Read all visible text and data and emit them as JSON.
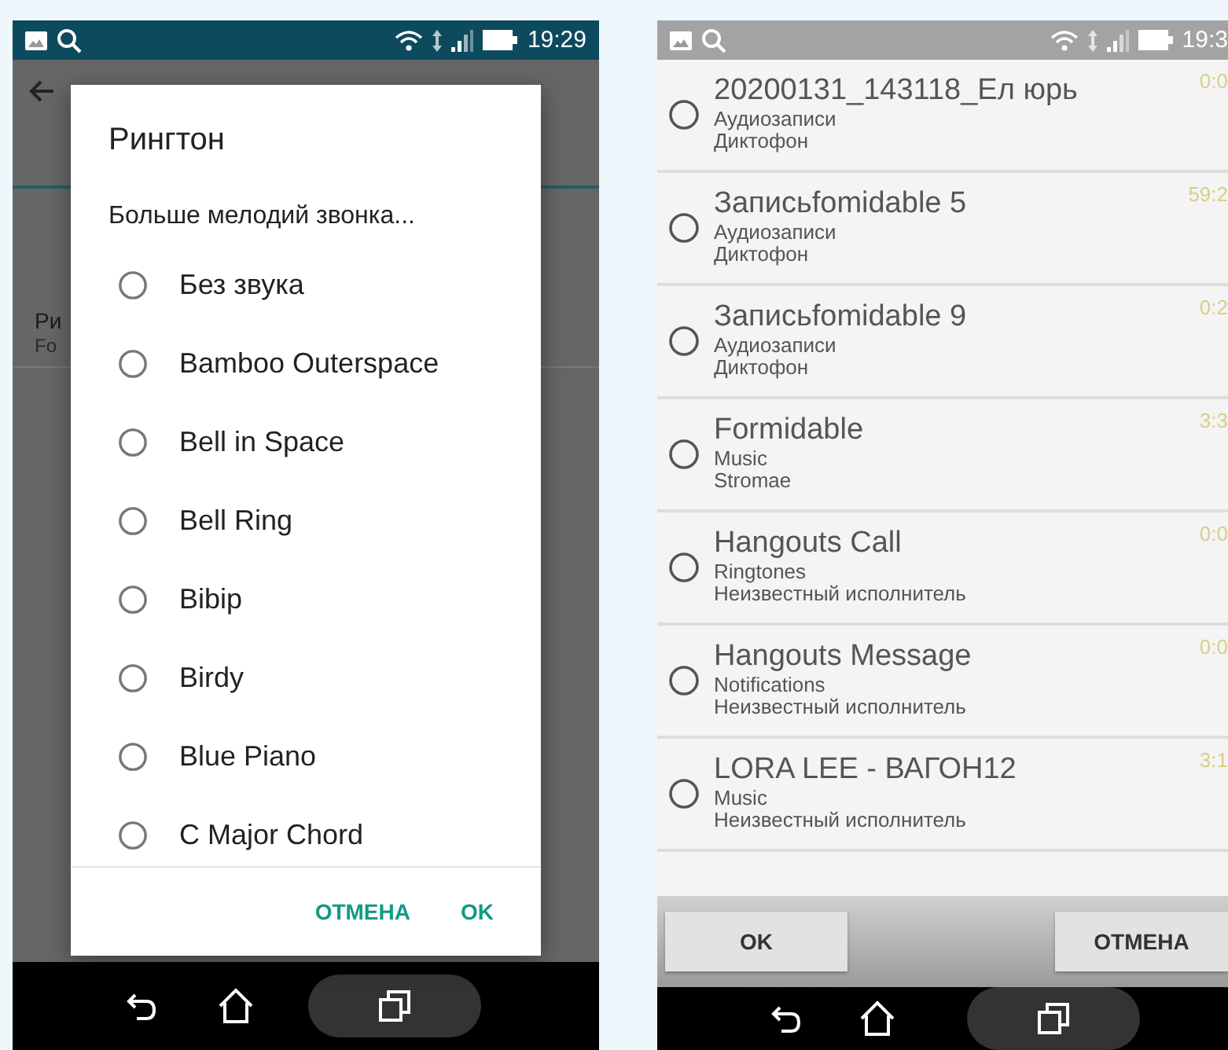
{
  "phones": [
    {
      "kind": "dialog",
      "status_time": "19:29",
      "background": {
        "title": "Ри",
        "subtitle": "Fo"
      },
      "dialog": {
        "title": "Рингтон",
        "more": "Больше мелодий звонка...",
        "options": [
          {
            "label": "Без звука",
            "selected": false
          },
          {
            "label": "Bamboo Outerspace",
            "selected": false
          },
          {
            "label": "Bell in Space",
            "selected": false
          },
          {
            "label": "Bell Ring",
            "selected": false
          },
          {
            "label": "Bibip",
            "selected": false
          },
          {
            "label": "Birdy",
            "selected": false
          },
          {
            "label": "Blue Piano",
            "selected": false
          },
          {
            "label": "C Major Chord",
            "selected": false
          }
        ],
        "buttons": [
          "ОТМЕНА",
          "OK"
        ]
      }
    },
    {
      "kind": "list",
      "status_time": "19:3",
      "rows": [
        {
          "title": "20200131_143118_Ел юрь",
          "album": "Аудиозаписи",
          "artist": "Диктофон",
          "duration": "0:0",
          "selected": false
        },
        {
          "title": "Записьfomidable 5",
          "album": "Аудиозаписи",
          "artist": "Диктофон",
          "duration": "59:2",
          "selected": false
        },
        {
          "title": "Записьfomidable 9",
          "album": "Аудиозаписи",
          "artist": "Диктофон",
          "duration": "0:2",
          "selected": false
        },
        {
          "title": "Formidable",
          "album": "Music",
          "artist": "Stromae",
          "duration": "3:3",
          "selected": false
        },
        {
          "title": "Hangouts Call",
          "album": "Ringtones",
          "artist": "Неизвестный исполнитель",
          "duration": "0:0",
          "selected": false
        },
        {
          "title": "Hangouts Message",
          "album": "Notifications",
          "artist": "Неизвестный исполнитель",
          "duration": "0:0",
          "selected": false
        },
        {
          "title": "LORA LEE - ВАГОН12",
          "album": "Music",
          "artist": "Неизвестный исполнитель",
          "duration": "3:1",
          "selected": false
        }
      ],
      "buttons": [
        "OK",
        "ОТМЕНА"
      ]
    }
  ]
}
